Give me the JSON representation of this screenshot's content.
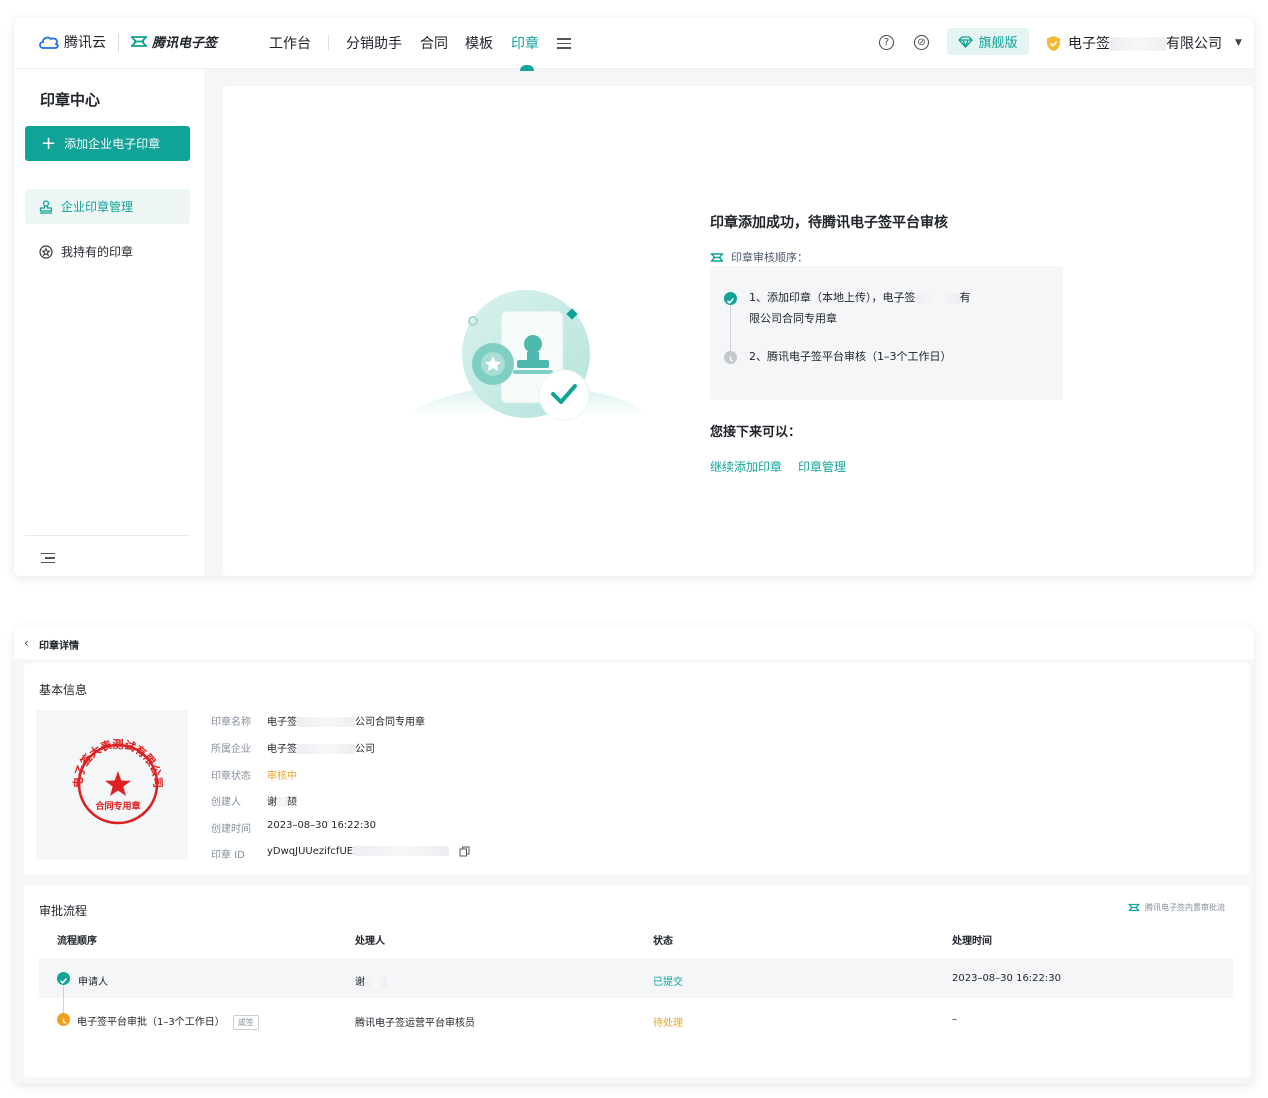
{
  "topbar": {
    "brand_cloud": "腾讯云",
    "brand_esign": "腾讯电子签",
    "nav": [
      "工作台",
      "分销助手",
      "合同",
      "模板",
      "印章"
    ],
    "active_nav": "印章",
    "flagship": "旗舰版",
    "company_prefix": "电子签",
    "company_suffix": "有限公司"
  },
  "sidebar": {
    "title": "印章中心",
    "add_button": "添加企业电子印章",
    "items": [
      "企业印章管理",
      "我持有的印章"
    ]
  },
  "result": {
    "title": "印章添加成功，待腾讯电子签平台审核",
    "order_label": "印章审核顺序：",
    "step1_line1_prefix": "1、添加印章（本地上传），电子签",
    "step1_line1_suffix": "有",
    "step1_line2": "限公司合同专用章",
    "step2": "2、腾讯电子签平台审核（1–3个工作日）",
    "next_title": "您接下来可以：",
    "links": [
      "继续添加印章",
      "印章管理"
    ]
  },
  "detail": {
    "back_title": "印章详情",
    "basic_title": "基本信息",
    "seal": {
      "ring_text": "电子签大表测试有限公司",
      "bottom_text": "合同专用章"
    },
    "fields": [
      {
        "label": "印章名称",
        "prefix": "电子签",
        "suffix": "公司合同专用章"
      },
      {
        "label": "所属企业",
        "prefix": "电子签",
        "suffix": "公司"
      },
      {
        "label": "印章状态",
        "prefix": "审核中",
        "suffix": ""
      },
      {
        "label": "创建人",
        "prefix": "谢",
        "suffix": "颉"
      },
      {
        "label": "创建时间",
        "prefix": "2023–08–30 16:22:30",
        "suffix": ""
      },
      {
        "label": "印章 ID",
        "prefix": "yDwqJUUezifcfUE",
        "suffix": ""
      }
    ],
    "approval_title": "审批流程",
    "builtin_label": "腾讯电子签内置审批流",
    "columns": [
      "流程顺序",
      "处理人",
      "状态",
      "处理时间"
    ],
    "rows": [
      {
        "step": "申请人",
        "handler": "谢",
        "status": "已提交",
        "time": "2023–08–30 16:22:30"
      },
      {
        "step": "电子签平台审批（1–3个工作日）",
        "badge": "或签",
        "handler": "腾讯电子签运营平台审核员",
        "status": "待处理",
        "time": "–"
      }
    ]
  },
  "colors": {
    "accent": "#10a398",
    "pending": "#f0a020",
    "seal_red": "#e02020"
  }
}
